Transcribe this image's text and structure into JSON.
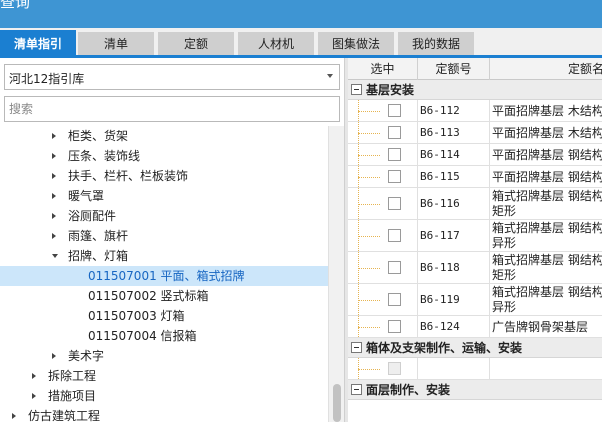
{
  "window": {
    "title": "查询"
  },
  "tabs": [
    {
      "label": "清单指引",
      "active": true
    },
    {
      "label": "清单",
      "active": false
    },
    {
      "label": "定额",
      "active": false
    },
    {
      "label": "人材机",
      "active": false
    },
    {
      "label": "图集做法",
      "active": false
    },
    {
      "label": "我的数据",
      "active": false
    }
  ],
  "library": {
    "selected": "河北12指引库"
  },
  "search": {
    "placeholder": "搜索"
  },
  "tree": [
    {
      "label": "柜类、货架",
      "level": 3,
      "expander": "collapsed"
    },
    {
      "label": "压条、装饰线",
      "level": 3,
      "expander": "collapsed"
    },
    {
      "label": "扶手、栏杆、栏板装饰",
      "level": 3,
      "expander": "collapsed"
    },
    {
      "label": "暖气罩",
      "level": 3,
      "expander": "collapsed"
    },
    {
      "label": "浴厕配件",
      "level": 3,
      "expander": "collapsed"
    },
    {
      "label": "雨篷、旗杆",
      "level": 3,
      "expander": "collapsed"
    },
    {
      "label": "招牌、灯箱",
      "level": 3,
      "expander": "expanded"
    },
    {
      "label": "011507001  平面、箱式招牌",
      "level": 4,
      "expander": "none",
      "selected": true
    },
    {
      "label": "011507002  竖式标箱",
      "level": 4,
      "expander": "none"
    },
    {
      "label": "011507003  灯箱",
      "level": 4,
      "expander": "none"
    },
    {
      "label": "011507004  信报箱",
      "level": 4,
      "expander": "none"
    },
    {
      "label": "美术字",
      "level": 3,
      "expander": "collapsed"
    },
    {
      "label": "拆除工程",
      "level": 2,
      "expander": "collapsed"
    },
    {
      "label": "措施项目",
      "level": 2,
      "expander": "collapsed"
    },
    {
      "label": "仿古建筑工程",
      "level": 1,
      "expander": "collapsed"
    }
  ],
  "grid": {
    "columns": [
      "选中",
      "定额号",
      "定额名称"
    ],
    "groups": [
      {
        "label": "基层安装",
        "rows": [
          {
            "code": "B6-112",
            "name": [
              "平面招牌基层  木结构"
            ]
          },
          {
            "code": "B6-113",
            "name": [
              "平面招牌基层  木结构"
            ]
          },
          {
            "code": "B6-114",
            "name": [
              "平面招牌基层  钢结构"
            ]
          },
          {
            "code": "B6-115",
            "name": [
              "平面招牌基层  钢结构"
            ]
          },
          {
            "code": "B6-116",
            "name": [
              "箱式招牌基层  钢结构",
              "矩形"
            ]
          },
          {
            "code": "B6-117",
            "name": [
              "箱式招牌基层  钢结构",
              "异形"
            ]
          },
          {
            "code": "B6-118",
            "name": [
              "箱式招牌基层  钢结构",
              "矩形"
            ]
          },
          {
            "code": "B6-119",
            "name": [
              "箱式招牌基层  钢结构",
              "异形"
            ]
          },
          {
            "code": "B6-124",
            "name": [
              "广告牌钢骨架基层"
            ]
          }
        ]
      },
      {
        "label": "箱体及支架制作、运输、安装",
        "rows": [
          {
            "code": "",
            "name": [
              ""
            ],
            "disabled": true
          }
        ]
      },
      {
        "label": "面层制作、安装",
        "rows": []
      }
    ]
  }
}
